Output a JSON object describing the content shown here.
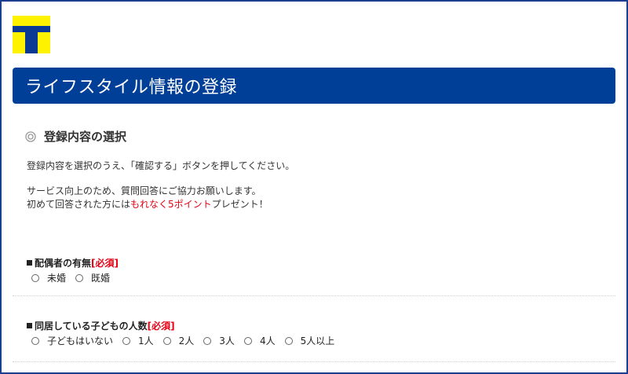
{
  "logo": {
    "name": "t-logo",
    "colors": {
      "yellow": "#fff200",
      "blue": "#0a3a94"
    }
  },
  "header": {
    "title": "ライフスタイル情報の登録",
    "background": "#003f98"
  },
  "section": {
    "icon": "double-circle-icon",
    "heading": "登録内容の選択",
    "instruction": "登録内容を選択のうえ、「確認する」ボタンを押してください。",
    "survey_line1": "サービス向上のため、質問回答にご協力お願いします。",
    "survey_line2_prefix": "初めて回答された方には",
    "survey_line2_highlight": "もれなく5ポイント",
    "survey_line2_suffix": "プレゼント！"
  },
  "questions": [
    {
      "label": "配偶者の有無",
      "required": "[必須]",
      "options": [
        "未婚",
        "既婚"
      ]
    },
    {
      "label": "同居している子どもの人数",
      "required": "[必須]",
      "options": [
        "子どもはいない",
        "1人",
        "2人",
        "3人",
        "4人",
        "5人以上"
      ]
    }
  ]
}
